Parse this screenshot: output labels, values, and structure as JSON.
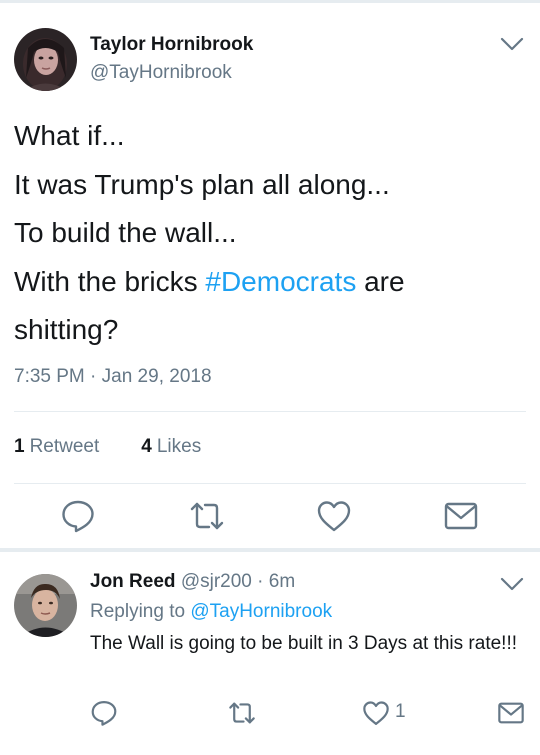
{
  "main_tweet": {
    "author_name": "Taylor Hornibrook",
    "author_handle": "@TayHornibrook",
    "text_lines": [
      "What if...",
      "It was Trump's plan all along...",
      "To build the wall...",
      "With the bricks ",
      "shitting?"
    ],
    "hashtag": "#Democrats",
    "hashtag_suffix": " are",
    "timestamp": "7:35 PM · Jan 29, 2018",
    "retweet_count": "1",
    "retweet_label": "Retweet",
    "like_count": "4",
    "like_label": "Likes"
  },
  "reply": {
    "author_name": "Jon Reed",
    "author_handle": "@sjr200",
    "time_ago": "· 6m",
    "replying_prefix": "Replying to ",
    "replying_to": "@TayHornibrook",
    "text": "The Wall is going to be built in 3 Days at this rate!!!",
    "like_count": "1"
  },
  "colors": {
    "accent": "#1da1f2",
    "secondary_text": "#657786",
    "primary_text": "#14171a",
    "divider": "#e6ecf0"
  },
  "icons": {
    "reply": "reply-icon",
    "retweet": "retweet-icon",
    "like": "heart-icon",
    "share": "envelope-icon",
    "menu": "chevron-down-icon"
  }
}
